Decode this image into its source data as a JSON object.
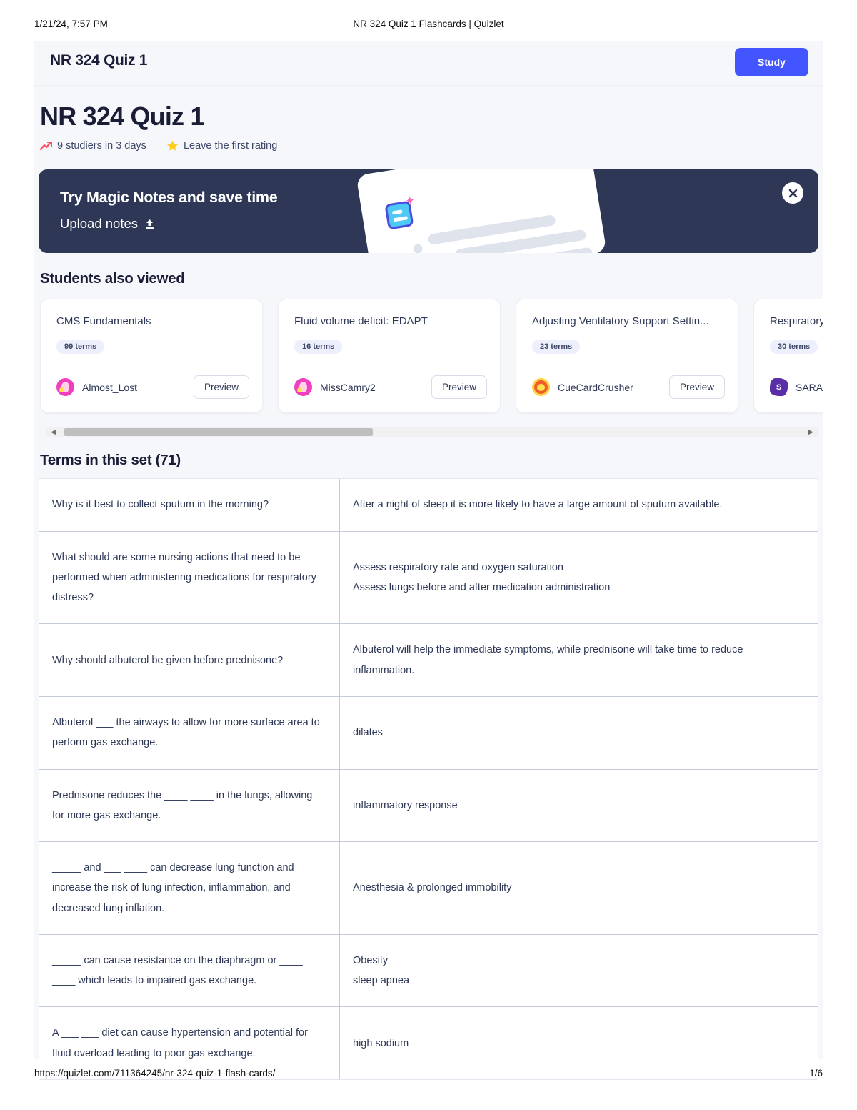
{
  "print": {
    "header_left": "1/21/24, 7:57 PM",
    "header_center": "NR 324 Quiz 1 Flashcards | Quizlet",
    "footer_url": "https://quizlet.com/711364245/nr-324-quiz-1-flash-cards/",
    "footer_page": "1/6"
  },
  "topbar": {
    "title": "NR 324 Quiz 1",
    "study_label": "Study"
  },
  "hero": {
    "title": "NR 324 Quiz 1",
    "studiers": "9 studiers in 3 days",
    "rating": "Leave the first rating"
  },
  "banner": {
    "title": "Try Magic Notes and save time",
    "subtitle": "Upload notes",
    "close_label": "×"
  },
  "students_also_viewed": {
    "heading": "Students also viewed",
    "preview_label": "Preview",
    "cards": [
      {
        "title": "CMS Fundamentals",
        "terms": "99 terms",
        "user": "Almost_Lost",
        "avatar": "flamingo",
        "avatar_letter": ""
      },
      {
        "title": "Fluid volume deficit: EDAPT",
        "terms": "16 terms",
        "user": "MissCamry2",
        "avatar": "flamingo",
        "avatar_letter": ""
      },
      {
        "title": "Adjusting Ventilatory Support Settin...",
        "terms": "23 terms",
        "user": "CueCardCrusher",
        "avatar": "lion",
        "avatar_letter": ""
      },
      {
        "title": "Respiratory",
        "terms": "30 terms",
        "user": "SARAH",
        "avatar": "letter",
        "avatar_letter": "S"
      }
    ]
  },
  "terms_section": {
    "heading": "Terms in this set (71)",
    "rows": [
      {
        "term": "Why is it best to collect sputum in the morning?",
        "definition": "After a night of sleep it is more likely to have a large amount of sputum available."
      },
      {
        "term": "What should are some nursing actions that need to be performed when administering medications for respiratory distress?",
        "definition": "Assess respiratory rate and oxygen saturation\nAssess lungs before and after medication administration"
      },
      {
        "term": "Why should albuterol be given before prednisone?",
        "definition": "Albuterol will help the immediate symptoms, while prednisone will take time to reduce inflammation."
      },
      {
        "term": "Albuterol ___ the airways to allow for more surface area to perform gas exchange.",
        "definition": "dilates"
      },
      {
        "term": "Prednisone reduces the ____ ____ in the lungs, allowing for more gas exchange.",
        "definition": "inflammatory response"
      },
      {
        "term": "_____ and ___ ____ can decrease lung function and increase the risk of lung infection, inflammation, and decreased lung inflation.",
        "definition": "Anesthesia & prolonged immobility"
      },
      {
        "term": "_____ can cause resistance on the diaphragm or ____ ____ which leads to impaired gas exchange.",
        "definition": "Obesity\nsleep apnea"
      },
      {
        "term": "A ___ ___ diet can cause hypertension and potential for fluid overload leading to poor gas exchange.",
        "definition": "high sodium"
      }
    ]
  },
  "colors": {
    "accent_blue": "#4255ff",
    "banner_navy": "#2e3856",
    "page_bg": "#f6f7fb",
    "star_yellow": "#ffcd1f",
    "trend_red": "#ff4f64"
  }
}
